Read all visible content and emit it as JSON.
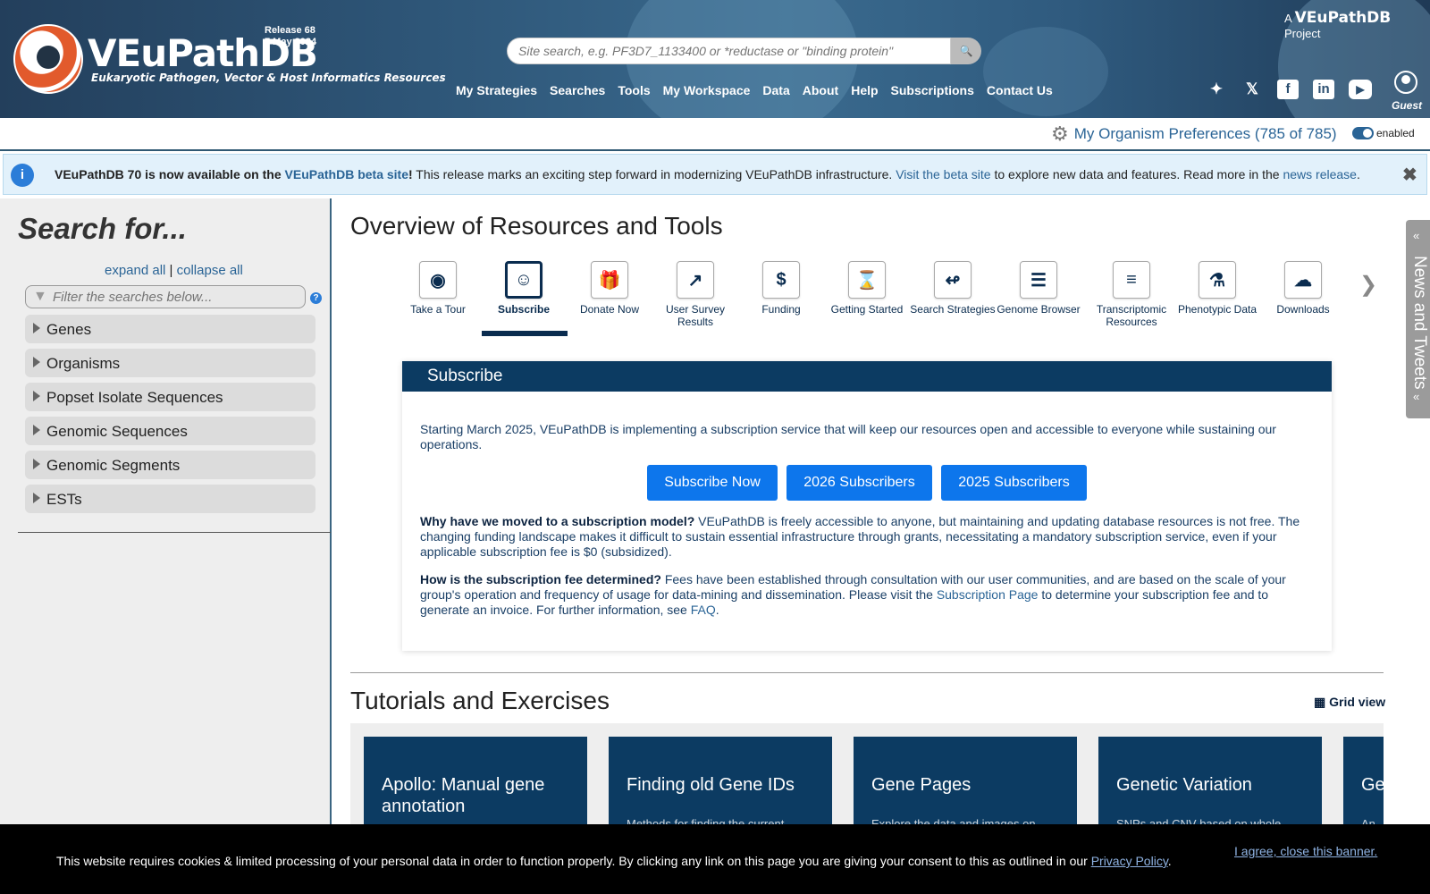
{
  "header": {
    "brand": "VEuPathDB",
    "tagline": "Eukaryotic Pathogen, Vector & Host Informatics Resources",
    "release_line1": "Release 68",
    "release_line2": "7 May 2024",
    "search_placeholder": "Site search, e.g. PF3D7_1133400 or *reductase or \"binding protein\"",
    "nav": [
      "My Strategies",
      "Searches",
      "Tools",
      "My Workspace",
      "Data",
      "About",
      "Help",
      "Subscriptions",
      "Contact Us"
    ],
    "a_prefix": "A",
    "a_brand": "VEuPathDB",
    "a_suffix": "Project",
    "guest_label": "Guest"
  },
  "prefs": {
    "label": "My Organism Preferences (785 of 785)",
    "enabled_label": "enabled"
  },
  "announce": {
    "bold": "VEuPathDB 70 is now available on the",
    "beta_link": "VEuPathDB beta site",
    "bang": "!",
    "text1": " This release marks an exciting step forward in modernizing VEuPathDB infrastructure.",
    "visit_link": "Visit the beta site",
    "text2": " to explore new data and features. Read more in the ",
    "news_link": "news release",
    "end": "."
  },
  "sidebar": {
    "title": "Search for...",
    "expand_all": "expand all",
    "sep": " | ",
    "collapse_all": "collapse all",
    "filter_placeholder": "Filter the searches below...",
    "categories": [
      "Genes",
      "Organisms",
      "Popset Isolate Sequences",
      "Genomic Sequences",
      "Genomic Segments",
      "ESTs"
    ]
  },
  "main": {
    "overview_title": "Overview of Resources and Tools",
    "tools": [
      {
        "label": "Take a Tour",
        "icon": "motorcycle-icon"
      },
      {
        "label": "Subscribe",
        "icon": "user-circle-icon"
      },
      {
        "label": "Donate Now",
        "icon": "gift-icon"
      },
      {
        "label": "User Survey Results",
        "icon": "chart-line-icon"
      },
      {
        "label": "Funding",
        "icon": "dollar-icon"
      },
      {
        "label": "Getting Started",
        "icon": "hourglass-icon"
      },
      {
        "label": "Search Strategies",
        "icon": "strategy-icon"
      },
      {
        "label": "Genome Browser",
        "icon": "sliders-icon"
      },
      {
        "label": "Transcriptomic Resources",
        "icon": "list-icon"
      },
      {
        "label": "Phenotypic Data",
        "icon": "flask-icon"
      },
      {
        "label": "Downloads",
        "icon": "cloud-download-icon"
      }
    ],
    "subscribe": {
      "heading": "Subscribe",
      "intro": "Starting March 2025, VEuPathDB is implementing a subscription service that will keep our resources open and accessible to everyone while sustaining our operations.",
      "btn_subscribe": "Subscribe Now",
      "btn_2026": "2026 Subscribers",
      "btn_2025": "2025 Subscribers",
      "why_q": "Why have we moved to a subscription model?",
      "why_a": " VEuPathDB is freely accessible to anyone, but maintaining and updating database resources is not free. The changing funding landscape makes it difficult to sustain essential infrastructure through grants, necessitating a mandatory subscription service, even if your applicable subscription fee is $0 (subsidized).",
      "how_q": "How is the subscription fee determined?",
      "how_a": " Fees have been established through consultation with our user communities, and are based on the scale of your group's operation and frequency of usage for data-mining and dissemination. Please visit the ",
      "sub_page_link": "Subscription Page",
      "how_a2": " to determine your subscription fee and to generate an invoice. For further information, see ",
      "faq_link": "FAQ",
      "end": "."
    },
    "tutorials_title": "Tutorials and Exercises",
    "grid_view": "Grid view",
    "tutorials": [
      {
        "title": "Apollo: Manual gene annotation",
        "desc": ""
      },
      {
        "title": "Finding old Gene IDs",
        "desc": "Methods for finding the current"
      },
      {
        "title": "Gene Pages",
        "desc": "Explore the data and images on"
      },
      {
        "title": "Genetic Variation",
        "desc": "SNPs and CNV based on whole"
      },
      {
        "title": "Ge",
        "desc": "An"
      }
    ],
    "news_tab": "News and Tweets"
  },
  "cookie": {
    "text": "This website requires cookies & limited processing of your personal data in order to function properly. By clicking any link on this page you are giving your consent to this as outlined in our ",
    "privacy_link": "Privacy Policy",
    "end": ".",
    "agree": "I agree, close this banner."
  }
}
